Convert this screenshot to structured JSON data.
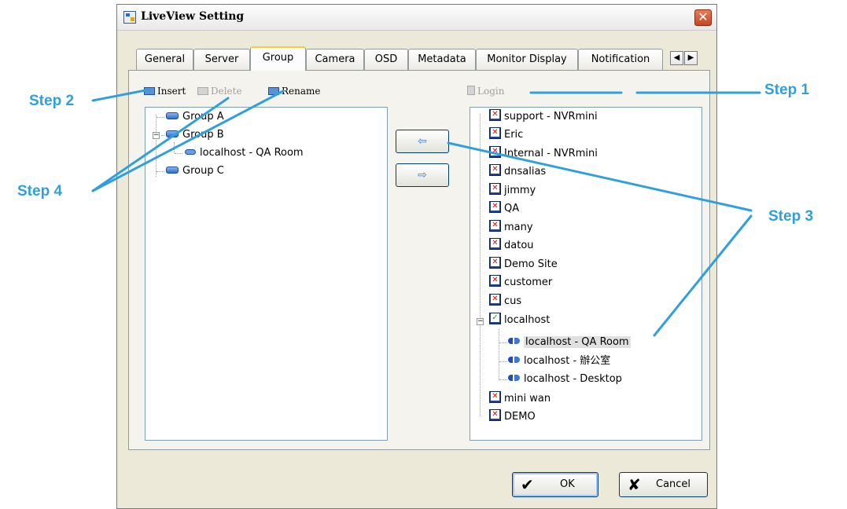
{
  "window": {
    "title": "LiveView Setting",
    "close_glyph": "✕"
  },
  "tabs": [
    "General",
    "Server",
    "Group",
    "Camera",
    "OSD",
    "Metadata",
    "Monitor Display",
    "Notification"
  ],
  "active_tab": "Group",
  "tab_scroll": {
    "left": "◀",
    "right": "▶"
  },
  "toolbar_left": {
    "insert": "Insert",
    "delete": "Delete",
    "rename": "Rename"
  },
  "toolbar_right": {
    "login": "Login"
  },
  "group_tree": [
    {
      "label": "Group A"
    },
    {
      "label": "Group B",
      "children": [
        {
          "label": "localhost - QA Room"
        }
      ]
    },
    {
      "label": "Group C"
    }
  ],
  "move_buttons": {
    "to_left": "⇦",
    "to_right": "⇨"
  },
  "server_tree": [
    "support - NVRmini",
    "Eric",
    "Internal - NVRmini",
    "dnsalias",
    "jimmy",
    "QA",
    "many",
    "datou",
    "Demo Site",
    "customer",
    "cus",
    "localhost",
    "localhost - QA Room",
    "localhost - 辦公室",
    "localhost - Desktop",
    "mini wan",
    "DEMO"
  ],
  "server_tree_status": {
    "connected": "localhost",
    "selected": "localhost - QA Room"
  },
  "buttons": {
    "ok": "OK",
    "ok_symbol": "✔",
    "cancel": "Cancel",
    "cancel_symbol": "✘"
  },
  "steps": {
    "step1": "Step 1",
    "step2": "Step 2",
    "step3": "Step 3",
    "step4": "Step 4"
  },
  "colors": {
    "annotation": "#2fa0dd",
    "tab_highlight": "#ffc83c",
    "dialog_bg": "#ece9d8"
  }
}
